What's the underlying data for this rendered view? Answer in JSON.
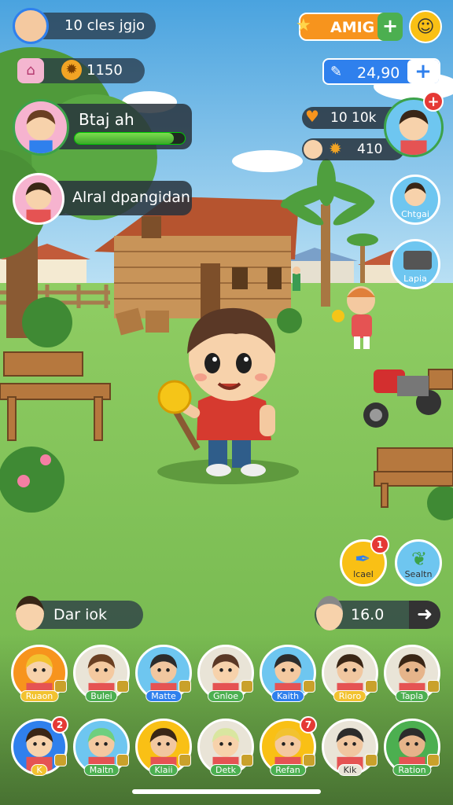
{
  "top_left": {
    "player_label": "10 cles jgjo",
    "resource_value": "1150"
  },
  "top_right": {
    "amig_label": "AMIG",
    "plus_symbol": "+",
    "gem_value": "24,90",
    "gem_plus_symbol": "+"
  },
  "left_cards": [
    {
      "name": "Btaj ah",
      "progress": 0.9
    },
    {
      "name": "Alral dpangidan"
    }
  ],
  "right_panel": {
    "stat1": "10 10k",
    "stat2": "410",
    "badge": "+"
  },
  "side_buttons": [
    {
      "label": "Chtgai"
    },
    {
      "label": "Lapia"
    }
  ],
  "action_buttons": [
    {
      "label": "lcael",
      "badge": "1"
    },
    {
      "label": "Sealtn"
    }
  ],
  "chat": {
    "name": "Dar iok"
  },
  "score": {
    "value": "16.0"
  },
  "roster_row1": [
    {
      "name": "Ruaon"
    },
    {
      "name": "Bulei"
    },
    {
      "name": "Matte"
    },
    {
      "name": "Gnloe"
    },
    {
      "name": "Kaith"
    },
    {
      "name": "Rioro"
    },
    {
      "name": "Tapla"
    }
  ],
  "roster_row2": [
    {
      "name": "K",
      "badge": "2"
    },
    {
      "name": "Maltn"
    },
    {
      "name": "Klaii"
    },
    {
      "name": "Detk"
    },
    {
      "name": "Refan",
      "badge": "7"
    },
    {
      "name": "Kik"
    },
    {
      "name": "Ration"
    }
  ],
  "colors": {
    "accent_orange": "#f7941d",
    "accent_green": "#4caf50",
    "accent_blue": "#2f80ed"
  }
}
